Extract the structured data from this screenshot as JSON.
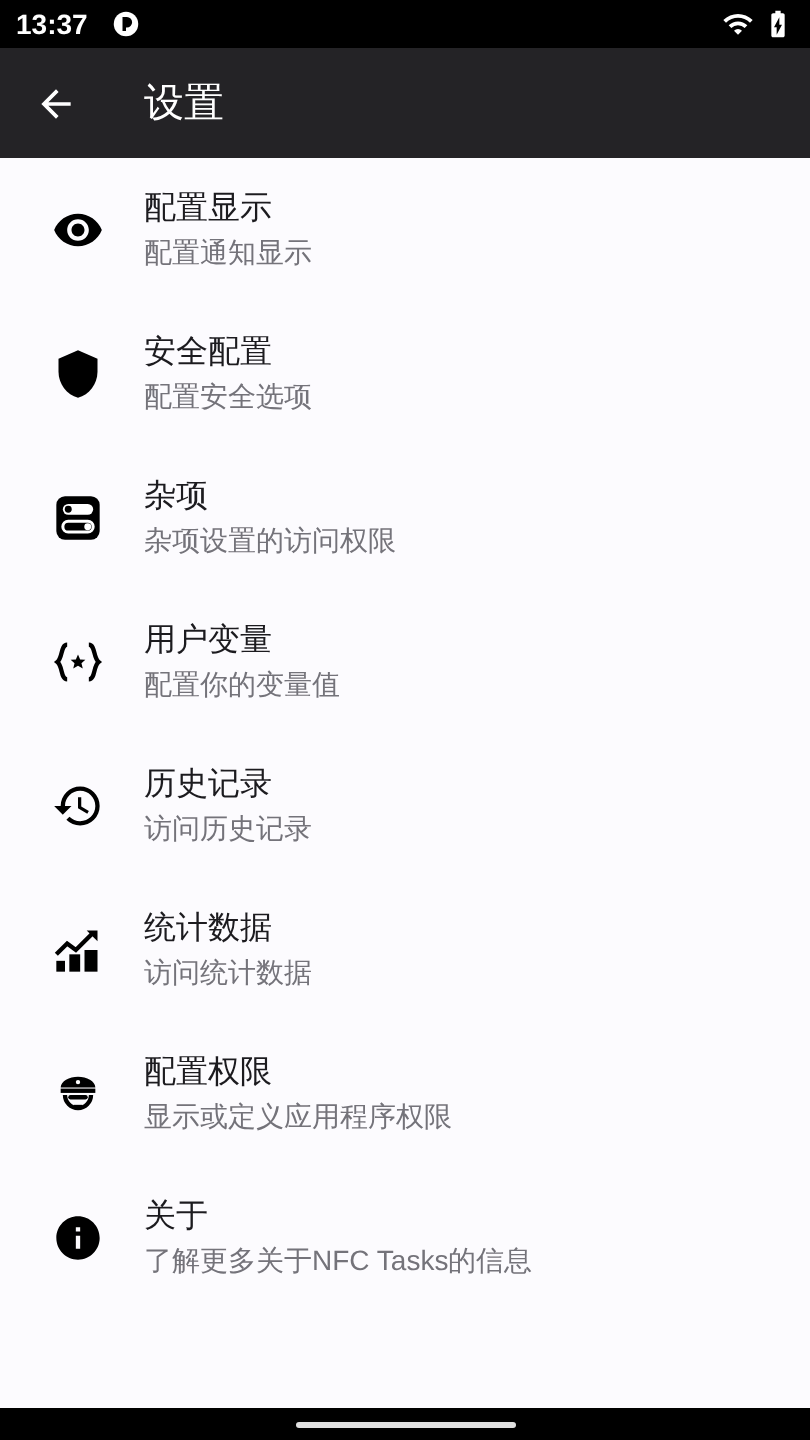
{
  "status_bar": {
    "time": "13:37"
  },
  "app_bar": {
    "title": "设置"
  },
  "items": [
    {
      "title": "配置显示",
      "subtitle": "配置通知显示"
    },
    {
      "title": "安全配置",
      "subtitle": "配置安全选项"
    },
    {
      "title": "杂项",
      "subtitle": "杂项设置的访问权限"
    },
    {
      "title": "用户变量",
      "subtitle": "配置你的变量值"
    },
    {
      "title": "历史记录",
      "subtitle": "访问历史记录"
    },
    {
      "title": "统计数据",
      "subtitle": "访问统计数据"
    },
    {
      "title": "配置权限",
      "subtitle": "显示或定义应用程序权限"
    },
    {
      "title": "关于",
      "subtitle": "了解更多关于NFC Tasks的信息"
    }
  ]
}
